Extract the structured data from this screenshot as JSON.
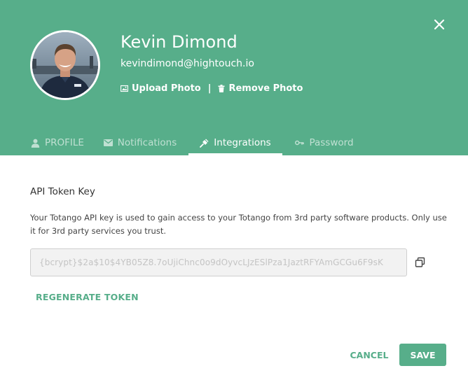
{
  "user": {
    "name": "Kevin Dimond",
    "email": "kevindimond@hightouch.io"
  },
  "photo_actions": {
    "upload_label": "Upload Photo",
    "separator": "|",
    "remove_label": "Remove Photo"
  },
  "tabs": [
    {
      "label": "PROFILE",
      "icon": "person-icon",
      "active": false
    },
    {
      "label": "Notifications",
      "icon": "mail-icon",
      "active": false
    },
    {
      "label": "Integrations",
      "icon": "plug-icon",
      "active": true
    },
    {
      "label": "Password",
      "icon": "key-icon",
      "active": false
    }
  ],
  "integrations": {
    "section_title": "API Token Key",
    "description": "Your Totango API key is used to gain access to your Totango from 3rd party software products. Only use it for 3rd party services you trust.",
    "token_value": "{bcrypt}$2a$10$4YB05Z8.7oUjiChnc0o9dOyvcLJzESlPza1JaztRFYAmGCGu6F9sK",
    "regenerate_label": "REGENERATE TOKEN"
  },
  "footer": {
    "cancel_label": "CANCEL",
    "save_label": "SAVE"
  },
  "colors": {
    "accent": "#57ae8a",
    "header_bg": "#57ae8a"
  }
}
